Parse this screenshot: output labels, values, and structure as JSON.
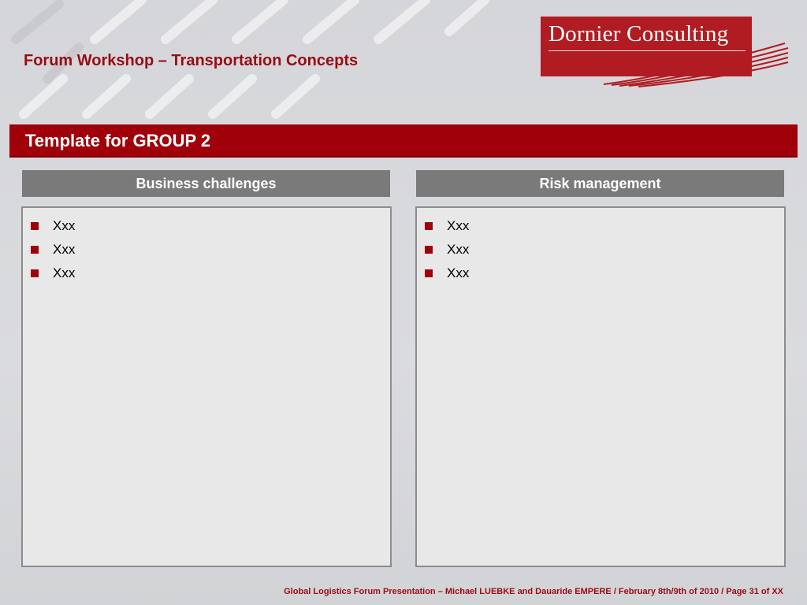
{
  "header": {
    "title": "Forum Workshop – Transportation Concepts",
    "logo_text": "Dornier Consulting"
  },
  "section": {
    "title": "Template for GROUP 2"
  },
  "columns": [
    {
      "header": "Business challenges",
      "items": [
        "Xxx",
        "Xxx",
        "Xxx"
      ]
    },
    {
      "header": "Risk management",
      "items": [
        "Xxx",
        "Xxx",
        "Xxx"
      ]
    }
  ],
  "footer": {
    "text": "Global Logistics Forum Presentation – Michael LUEBKE and Dauaride EMPERE / February 8th/9th of 2010 / Page 31 of XX"
  },
  "colors": {
    "brand_red": "#a0000a",
    "header_gray": "#7a7a7a",
    "background": "#d5d6d9"
  }
}
